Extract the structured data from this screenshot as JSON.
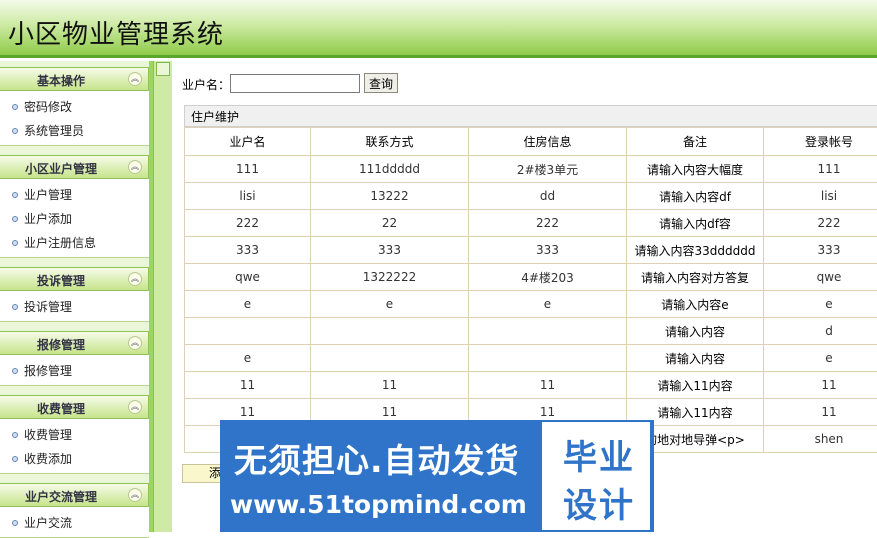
{
  "app": {
    "title": "小区物业管理系统"
  },
  "sidebar": {
    "groups": [
      {
        "title": "基本操作",
        "items": [
          "密码修改",
          "系统管理员"
        ]
      },
      {
        "title": "小区业户管理",
        "items": [
          "业户管理",
          "业户添加",
          "业户注册信息"
        ]
      },
      {
        "title": "投诉管理",
        "items": [
          "投诉管理"
        ]
      },
      {
        "title": "报修管理",
        "items": [
          "报修管理"
        ]
      },
      {
        "title": "收费管理",
        "items": [
          "收费管理",
          "收费添加"
        ]
      },
      {
        "title": "业户交流管理",
        "items": [
          "业户交流"
        ]
      }
    ]
  },
  "search": {
    "label": "业户名：",
    "value": "",
    "button": "查询"
  },
  "panel": {
    "title": "住户维护",
    "columns": [
      "业户名",
      "联系方式",
      "住房信息",
      "备注",
      "登录帐号"
    ],
    "rows": [
      [
        "111",
        "111ddddd",
        "2#楼3单元",
        "请输入内容大幅度",
        "111"
      ],
      [
        "lisi",
        "13222",
        "dd",
        "请输入内容df",
        "lisi"
      ],
      [
        "222",
        "22",
        "222",
        "请输入内df容",
        "222"
      ],
      [
        "333",
        "333",
        "333",
        "请输入内容33dddddd",
        "333"
      ],
      [
        "qwe",
        "1322222",
        "4#楼203",
        "请输入内容对方答复",
        "qwe"
      ],
      [
        "e",
        "e",
        "e",
        "请输入内容e",
        "e"
      ],
      [
        "",
        "",
        "",
        "请输入内容",
        "d"
      ],
      [
        "e",
        "",
        "",
        "请输入内容",
        "e"
      ],
      [
        "11",
        "11",
        "11",
        "请输入11内容",
        "11"
      ],
      [
        "11",
        "11",
        "11",
        "请输入11内容",
        "11"
      ],
      [
        "",
        "",
        "",
        "的地对地导弹<p>",
        "shen"
      ]
    ]
  },
  "add_button": "添",
  "watermark": {
    "line1": "无须担心.自动发货",
    "line2": "www.51topmind.com",
    "badge1": "毕业",
    "badge2": "设计"
  }
}
